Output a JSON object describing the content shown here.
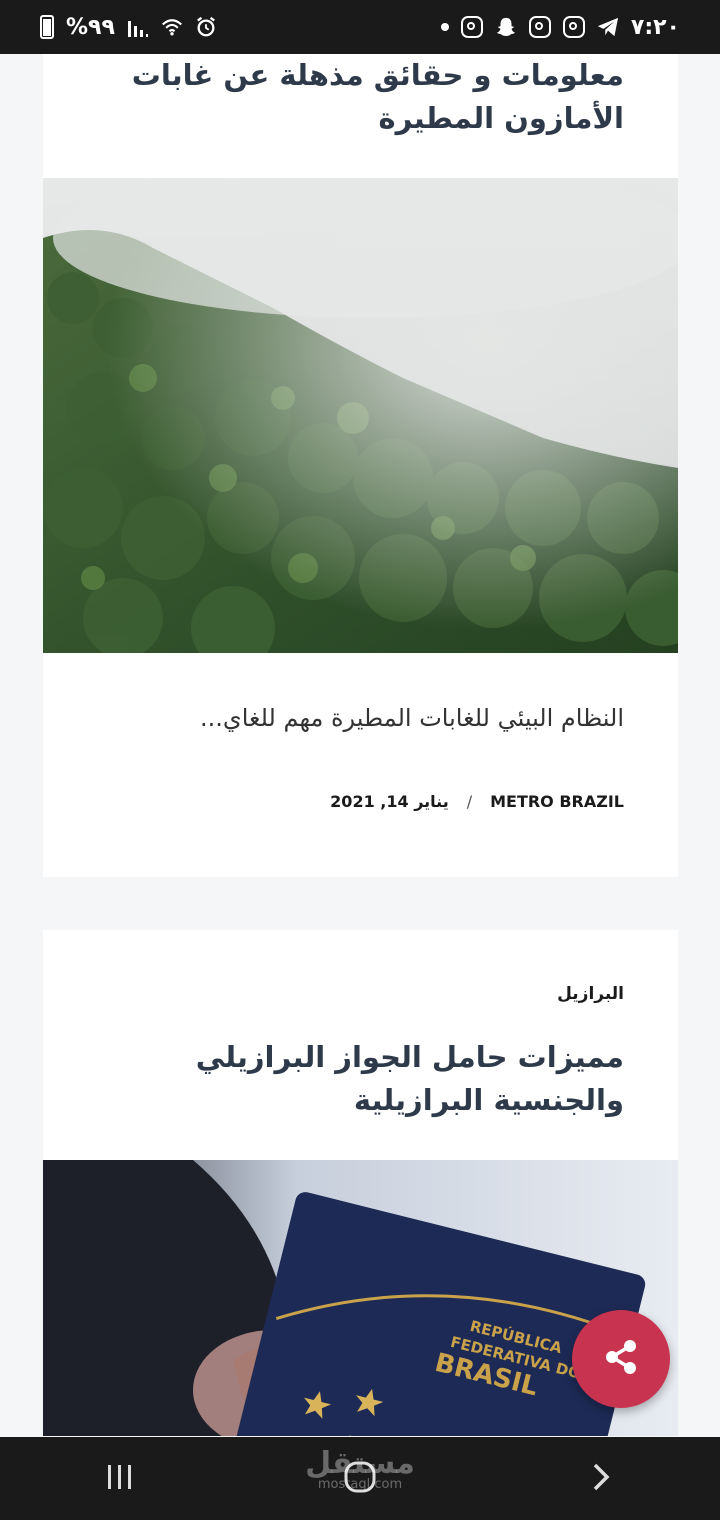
{
  "status_bar": {
    "battery_percent": "%٩٩",
    "time": "٧:٢٠",
    "left_icons": [
      "battery-icon",
      "signal-icon",
      "wifi-icon",
      "alarm-icon"
    ],
    "right_icons": [
      "dot-icon",
      "instagram-icon",
      "snapchat-icon",
      "instagram-icon",
      "instagram-icon",
      "telegram-icon"
    ]
  },
  "articles": [
    {
      "title": "معلومات و حقائق مذهلة عن غابات الأمازون المطيرة",
      "image": "foggy-rainforest-photo",
      "excerpt": "النظام البيئي للغابات المطيرة مهم للغاي...",
      "author": "METRO BRAZIL",
      "separator": "/",
      "date": "يناير 14, 2021"
    },
    {
      "category": "البرازيل",
      "title": "مميزات حامل الجواز البرازيلي والجنسية البرازيلية",
      "image": "brazil-passport-photo",
      "passport_text_1": "REPÚBLICA",
      "passport_text_2": "FEDERATIVA DO",
      "passport_text_3": "BRASIL"
    }
  ],
  "share_button": {
    "icon": "share-icon",
    "color": "#c8334f"
  },
  "navbar": {
    "buttons": [
      "recent-apps-icon",
      "home-icon",
      "back-icon"
    ],
    "watermark": "مستقل",
    "watermark_sub": "mostaql.com"
  }
}
